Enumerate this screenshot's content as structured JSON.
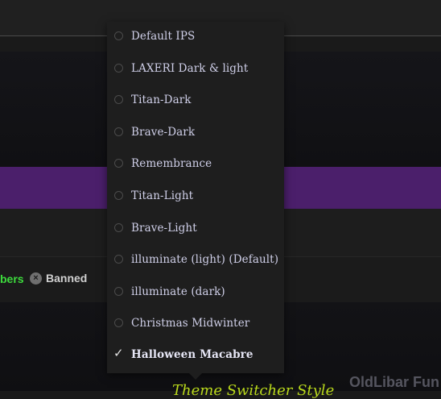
{
  "stats": {
    "members_label": "bers",
    "banned_label": "Banned",
    "banned_icon": "x-circle-icon"
  },
  "footer": {
    "brand_text": "OldLibar Fun",
    "partial_text": "Theme Switcher Style"
  },
  "theme_menu": {
    "items": [
      {
        "label": "Default IPS",
        "selected": false
      },
      {
        "label": "LAXERI Dark & light",
        "selected": false
      },
      {
        "label": "Titan-Dark",
        "selected": false
      },
      {
        "label": "Brave-Dark",
        "selected": false
      },
      {
        "label": "Remembrance",
        "selected": false
      },
      {
        "label": "Titan-Light",
        "selected": false
      },
      {
        "label": "Brave-Light",
        "selected": false
      },
      {
        "label": "illuminate (light) (Default)",
        "selected": false
      },
      {
        "label": "illuminate (dark)",
        "selected": false
      },
      {
        "label": "Christmas Midwinter",
        "selected": false
      },
      {
        "label": "Halloween Macabre",
        "selected": true
      }
    ]
  },
  "colors": {
    "accent_purple": "#4b1f6b",
    "online_green": "#3ddc3d",
    "theme_yellow": "#b9d81c",
    "menu_bg": "#1e1e1e"
  }
}
